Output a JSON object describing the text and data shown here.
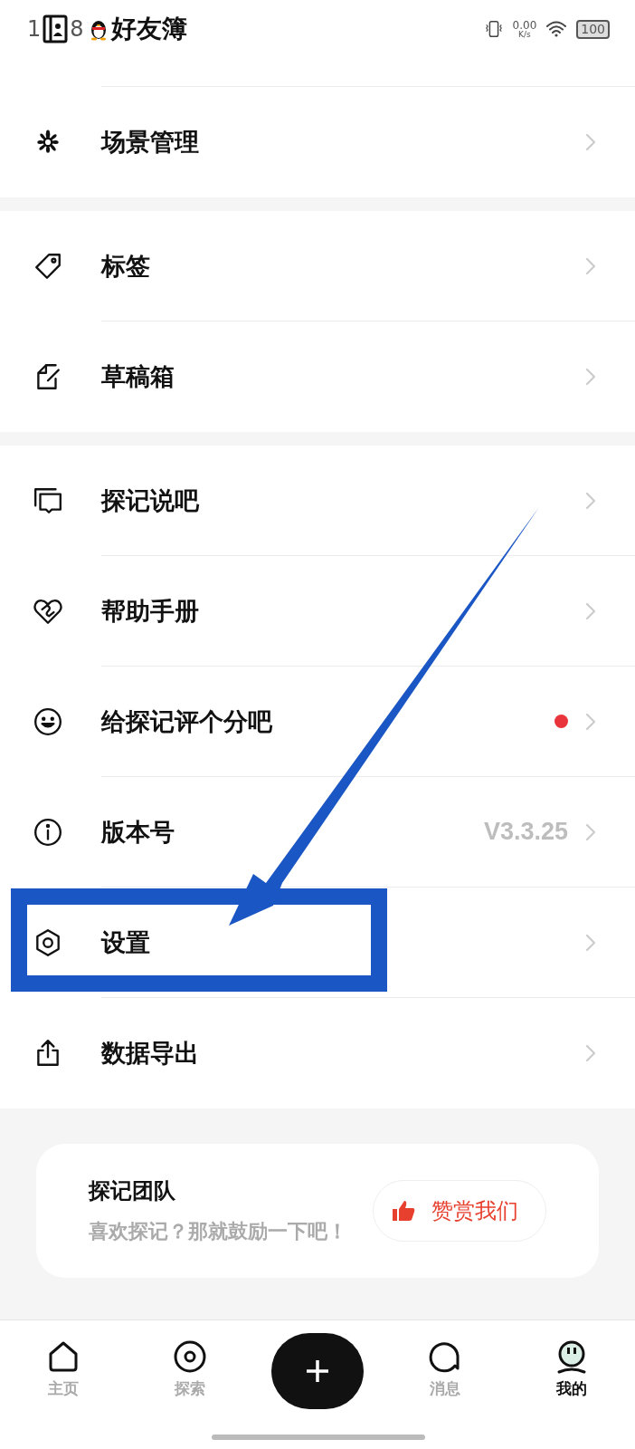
{
  "status_bar": {
    "time_parts": [
      "1",
      "8"
    ],
    "notification_title": "好友簿",
    "network_speed": "0.00",
    "network_unit": "K/s",
    "battery": "100"
  },
  "sections": [
    {
      "items": [
        {
          "label": "场景管理",
          "value": "",
          "has_dot": false
        }
      ]
    },
    {
      "items": [
        {
          "label": "标签",
          "has_dot": false
        },
        {
          "label": "草稿箱",
          "has_dot": false
        }
      ]
    },
    {
      "items": [
        {
          "label": "探记说吧",
          "has_dot": false
        },
        {
          "label": "帮助手册",
          "has_dot": false
        },
        {
          "label": "给探记评个分吧",
          "has_dot": true
        },
        {
          "label": "版本号",
          "value": "V3.3.25",
          "has_dot": false
        },
        {
          "label": "设置",
          "has_dot": false
        },
        {
          "label": "数据导出",
          "has_dot": false
        }
      ]
    }
  ],
  "team_card": {
    "title": "探记团队",
    "subtitle": "喜欢探记？那就鼓励一下吧！",
    "button": "赞赏我们"
  },
  "bottom_nav": [
    {
      "label": "主页",
      "selected": false
    },
    {
      "label": "探索",
      "selected": false
    },
    {
      "label": "消息",
      "selected": false
    },
    {
      "label": "我的",
      "selected": true
    }
  ]
}
